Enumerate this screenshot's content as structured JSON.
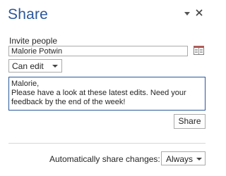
{
  "pane": {
    "title": "Share"
  },
  "invite": {
    "label": "Invite people",
    "value": "Malorie Potwin"
  },
  "permission": {
    "selected": "Can edit"
  },
  "message": {
    "text": "Malorie,\nPlease have a look at these latest edits. Need your feedback by the end of the week!"
  },
  "share_button": {
    "label": "Share"
  },
  "auto_share": {
    "label": "Automatically share changes:",
    "selected": "Always"
  },
  "colors": {
    "title": "#2b579a",
    "focus_border": "#2b579a",
    "address_book_red": "#c0504d"
  },
  "icons": {
    "title_menu": "chevron-down-icon",
    "close": "close-icon",
    "address_book": "address-book-icon"
  }
}
